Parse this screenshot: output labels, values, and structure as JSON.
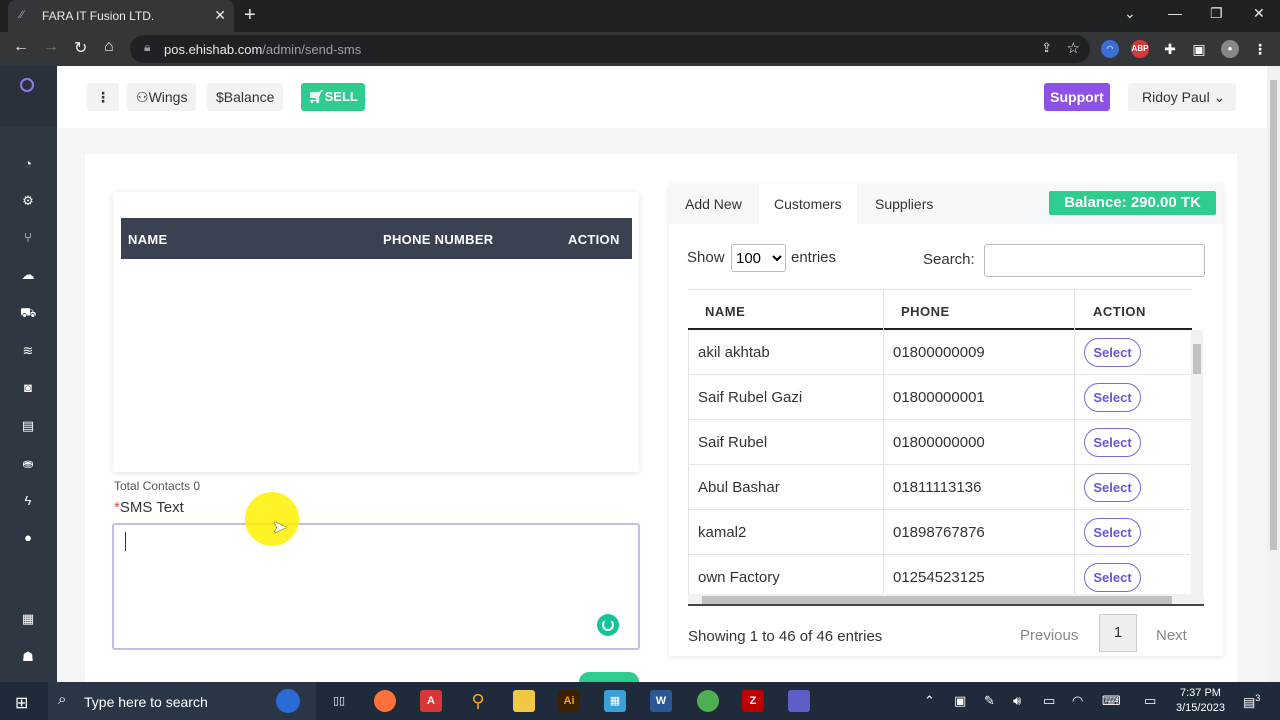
{
  "browser": {
    "tab_title": "FARA IT Fusion LTD.",
    "url_host": "pos.ehishab.com",
    "url_path": "/admin/send-sms"
  },
  "topnav": {
    "wings_label": "Wings",
    "balance_label": "Balance",
    "sell_label": "SELL",
    "support_label": "Support",
    "user_name": "Ridoy Paul"
  },
  "contacts_table": {
    "columns": [
      "NAME",
      "PHONE NUMBER",
      "ACTION"
    ],
    "total_label": "Total Contacts 0"
  },
  "sms": {
    "required_mark": "*",
    "label": "SMS Text",
    "value": ""
  },
  "right": {
    "tabs": [
      "Add New",
      "Customers",
      "Suppliers"
    ],
    "balance_badge": "Balance: 290.00 TK",
    "show_label": "Show",
    "entries_value": "100",
    "entries_label": "entries",
    "search_label": "Search:",
    "columns": [
      "NAME",
      "PHONE",
      "ACTION"
    ],
    "rows": [
      {
        "name": "akil akhtab",
        "phone": "01800000009",
        "action": "Select"
      },
      {
        "name": "Saif Rubel Gazi",
        "phone": "01800000001",
        "action": "Select"
      },
      {
        "name": "Saif Rubel",
        "phone": "01800000000",
        "action": "Select"
      },
      {
        "name": "Abul Bashar",
        "phone": "01811113136",
        "action": "Select"
      },
      {
        "name": "kamal2",
        "phone": "01898767876",
        "action": "Select"
      },
      {
        "name": "own Factory",
        "phone": "01254523125",
        "action": "Select"
      }
    ],
    "info": "Showing 1 to 46 of 46 entries",
    "prev_label": "Previous",
    "page": "1",
    "next_label": "Next"
  },
  "taskbar": {
    "search_placeholder": "Type here to search",
    "time": "7:37 PM",
    "date": "3/15/2023",
    "notifications": "3"
  },
  "colors": {
    "sidebar": "#2f3742",
    "sell_green": "#2ecc8f",
    "support_purple": "#8c52e8",
    "table_header": "#3a4150"
  }
}
